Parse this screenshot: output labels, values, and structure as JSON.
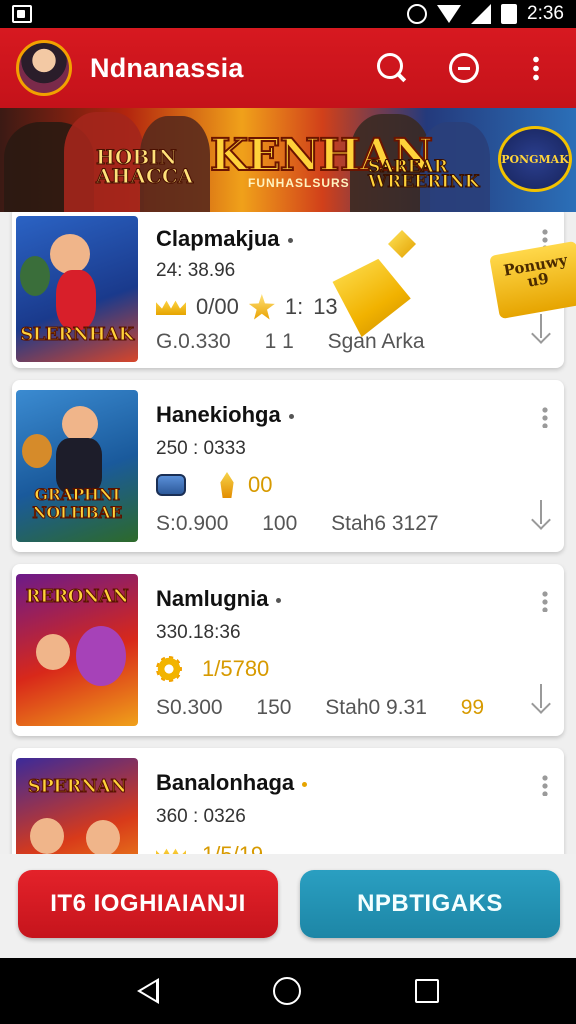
{
  "status_bar": {
    "time": "2:36"
  },
  "app_bar": {
    "title": "Ndnanassia"
  },
  "banner": {
    "left_text": "HOBIN\nAHACCA",
    "title": "KENHAN",
    "subtitle": "FUNHASLSURS",
    "right_text": "SAREAR\nWREERINK",
    "badge_text": "PONGMAK"
  },
  "games": [
    {
      "name": "Clapmakjua",
      "meta": "24: 38.96",
      "badge_values": [
        "0/00",
        "1:",
        "13"
      ],
      "stat_1": "G.0.330",
      "stat_2": "1 1",
      "stat_3": "Sgan Arka",
      "thumb_text": "SLERNHAK"
    },
    {
      "name": "Hanekiohga",
      "meta": "250 : 0333",
      "badge_values": [
        "00"
      ],
      "stat_1": "S:0.900",
      "stat_2": "100",
      "stat_3": "Stah6 3127",
      "thumb_text": "GRAPHNI NOLHBAE"
    },
    {
      "name": "Namlugnia",
      "meta": "330.18:36",
      "badge_values": [
        "1/5780"
      ],
      "stat_1": "S0.300",
      "stat_2": "150",
      "stat_3": "Stah0 9.31",
      "stat_4": "99",
      "thumb_text": "RERONAN"
    },
    {
      "name": "Banalonhaga",
      "meta": "360 : 0326",
      "badge_values": [
        "1/5/19"
      ],
      "thumb_text": "SPERNAN"
    }
  ],
  "promo": {
    "tag_text": "Ponuwy u9"
  },
  "actions": {
    "primary_label": "IT6 IOGHIAIANJI",
    "secondary_label": "NPBTIGAKS"
  },
  "colors": {
    "app_bar": "#d71920",
    "primary_button": "#e4222a",
    "secondary_button": "#2a9fc1",
    "accent_gold": "#f2b400"
  },
  "icons": [
    "search-icon",
    "minus-circle-icon",
    "more-vert-icon",
    "download-icon",
    "back-icon",
    "home-icon",
    "recents-icon"
  ]
}
